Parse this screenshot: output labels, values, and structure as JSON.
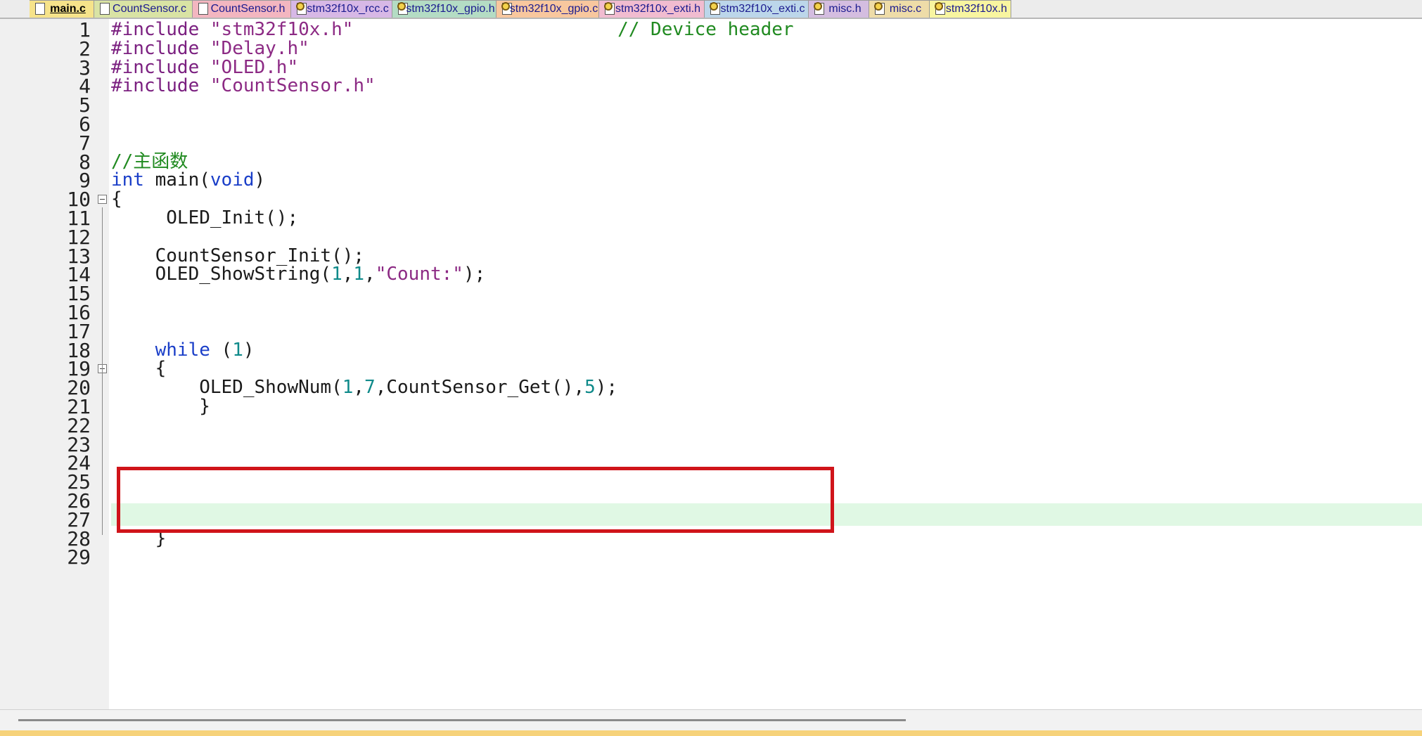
{
  "tabs": [
    {
      "label": "main.c",
      "color": "#f6e38a",
      "active": true,
      "icon": "file-icon"
    },
    {
      "label": "CountSensor.c",
      "color": "#d9e3a4",
      "active": false,
      "icon": "file-icon"
    },
    {
      "label": "CountSensor.h",
      "color": "#f3b6c0",
      "active": false,
      "icon": "file-icon"
    },
    {
      "label": "stm32f10x_rcc.c",
      "color": "#d7b8e6",
      "active": false,
      "icon": "gear-file-icon"
    },
    {
      "label": "stm32f10x_gpio.h",
      "color": "#b4dcc4",
      "active": false,
      "icon": "gear-file-icon"
    },
    {
      "label": "stm32f10x_gpio.c",
      "color": "#f8c79e",
      "active": false,
      "icon": "gear-file-icon"
    },
    {
      "label": "stm32f10x_exti.h",
      "color": "#f1bcd0",
      "active": false,
      "icon": "gear-file-icon"
    },
    {
      "label": "stm32f10x_exti.c",
      "color": "#bcd6ea",
      "active": false,
      "icon": "gear-file-icon"
    },
    {
      "label": "misc.h",
      "color": "#d4bde0",
      "active": false,
      "icon": "gear-file-icon"
    },
    {
      "label": "misc.c",
      "color": "#eedca8",
      "active": false,
      "icon": "gear-file-icon"
    },
    {
      "label": "stm32f10x.h",
      "color": "#f8f5a0",
      "active": false,
      "icon": "gear-file-icon"
    }
  ],
  "editor": {
    "line_numbers": [
      "1",
      "2",
      "3",
      "4",
      "5",
      "6",
      "7",
      "8",
      "9",
      "10",
      "11",
      "12",
      "13",
      "14",
      "15",
      "16",
      "17",
      "18",
      "19",
      "20",
      "21",
      "22",
      "23",
      "24",
      "25",
      "26",
      "27",
      "28",
      "29"
    ],
    "highlighted_line": 20,
    "colors": {
      "keyword": "#1a3ec8",
      "preprocessor": "#7b2080",
      "string": "#8c2a84",
      "number": "#0f8a8a",
      "comment": "#208a20",
      "highlight": "#e0f8e4",
      "annotation_box": "#d0141a"
    },
    "lines": {
      "l1": {
        "pre": "#include",
        "str": " \"stm32f10x.h\"",
        "pad": "                        ",
        "cmt": "// Device header"
      },
      "l2": {
        "pre": "#include",
        "str": " \"Delay.h\""
      },
      "l3": {
        "pre": "#include",
        "str": " \"OLED.h\""
      },
      "l4": {
        "pre": "#include",
        "str": " \"CountSensor.h\""
      },
      "l8": {
        "cmt": "//主函数"
      },
      "l9": {
        "kw1": "int",
        "mid": " main(",
        "kw2": "void",
        "end": ")"
      },
      "l10": {
        "text": "{"
      },
      "l11": {
        "text": "     OLED_Init();"
      },
      "l13": {
        "text": "    CountSensor_Init();"
      },
      "l14": {
        "a": "    OLED_ShowString(",
        "n1": "1",
        ",": ",",
        "n2": "1",
        "b": ",",
        "s": "\"Count:\"",
        "c": ");"
      },
      "l18": {
        "a": "    ",
        "kw": "while",
        "b": " (",
        "n": "1",
        "c": ")"
      },
      "l19": {
        "text": "    {"
      },
      "l20": {
        "a": "        OLED_ShowNum(",
        "n1": "1",
        "c1": ",",
        "n2": "7",
        "b": ",CountSensor_Get(),",
        "n3": "5",
        "c": ");"
      },
      "l21": {
        "text": "        }"
      },
      "l28": {
        "text": "    }"
      }
    }
  }
}
